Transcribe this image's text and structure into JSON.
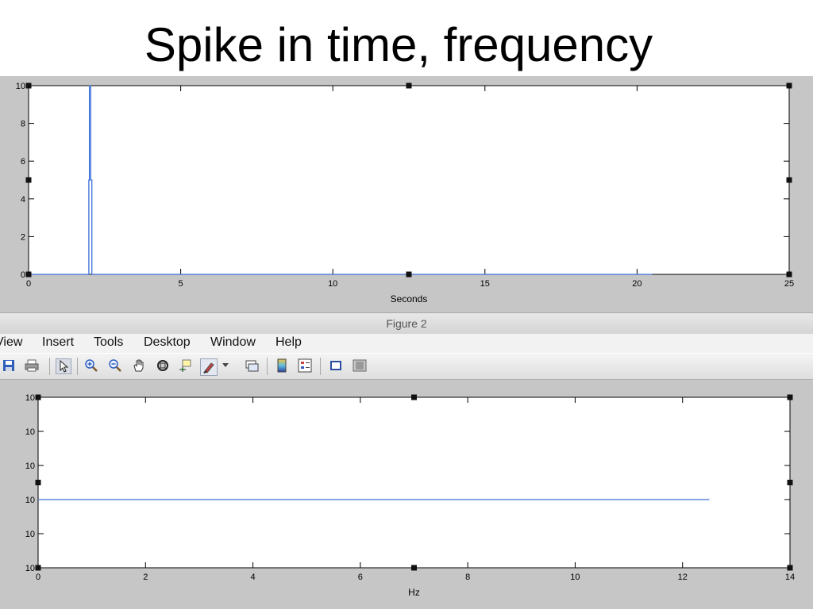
{
  "slide": {
    "title": "Spike in time, frequency"
  },
  "figure2": {
    "window_title": "Figure 2",
    "menu": [
      "View",
      "Insert",
      "Tools",
      "Desktop",
      "Window",
      "Help"
    ],
    "toolbar_icons": [
      "save-icon",
      "print-icon",
      "pointer-icon",
      "zoom-in-icon",
      "zoom-out-icon",
      "pan-hand-icon",
      "rotate-3d-icon",
      "data-cursor-icon",
      "brush-icon",
      "dropdown-arrow-icon",
      "link-plot-icon",
      "colorbar-icon",
      "legend-icon",
      "hide-plot-tools-icon",
      "show-plot-tools-icon"
    ]
  },
  "chart_data": [
    {
      "type": "line",
      "xlabel": "Seconds",
      "xlim": [
        0,
        25
      ],
      "ylim": [
        0,
        10
      ],
      "x_ticks": [
        "0",
        "5",
        "10",
        "15",
        "20",
        "25"
      ],
      "y_ticks": [
        "0",
        "2",
        "4",
        "6",
        "8",
        "10"
      ],
      "series_color": "#3b6fd6",
      "series": [
        {
          "x": [
            0,
            1.98,
            1.98,
            2.0,
            2.0,
            2.04,
            2.04,
            2.08,
            2.08,
            20.5
          ],
          "y": [
            0,
            0,
            5,
            5,
            10,
            10,
            5,
            5,
            0,
            0
          ]
        }
      ]
    },
    {
      "type": "line",
      "xlabel": "Hz",
      "xlim": [
        0,
        14
      ],
      "ylim": [
        0,
        5
      ],
      "x_ticks": [
        "0",
        "2",
        "4",
        "6",
        "8",
        "10",
        "12",
        "14"
      ],
      "y_ticks": [
        "10",
        "10",
        "10",
        "10",
        "10",
        "10"
      ],
      "series_color": "#3b6fd6",
      "series": [
        {
          "x": [
            0,
            12.5
          ],
          "y": [
            2,
            2
          ]
        }
      ]
    }
  ]
}
